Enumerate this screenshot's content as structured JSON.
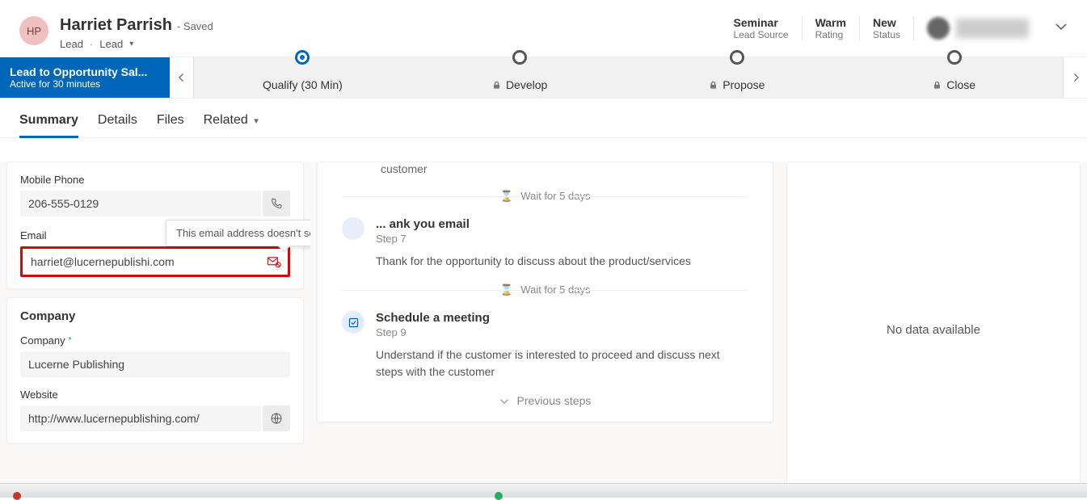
{
  "header": {
    "avatar_initials": "HP",
    "name": "Harriet Parrish",
    "saved": "- Saved",
    "entity": "Lead",
    "form": "Lead",
    "meta": [
      {
        "value": "Seminar",
        "label": "Lead Source"
      },
      {
        "value": "Warm",
        "label": "Rating"
      },
      {
        "value": "New",
        "label": "Status"
      }
    ]
  },
  "process": {
    "name": "Lead to Opportunity Sal...",
    "duration": "Active for 30 minutes",
    "stages": [
      {
        "label": "Qualify  (30 Min)",
        "active": true,
        "locked": false
      },
      {
        "label": "Develop",
        "active": false,
        "locked": true
      },
      {
        "label": "Propose",
        "active": false,
        "locked": true
      },
      {
        "label": "Close",
        "active": false,
        "locked": true
      }
    ]
  },
  "tabs": [
    {
      "label": "Summary",
      "active": true
    },
    {
      "label": "Details",
      "active": false
    },
    {
      "label": "Files",
      "active": false
    },
    {
      "label": "Related",
      "active": false,
      "dropdown": true
    }
  ],
  "fields": {
    "mobile_label": "Mobile Phone",
    "mobile_value": "206-555-0129",
    "email_label": "Email",
    "email_value": "harriet@lucernepublishi.com",
    "email_tooltip": "This email address doesn't seem to be valid.",
    "company_section": "Company",
    "company_label": "Company",
    "company_value": "Lucerne Publishing",
    "website_label": "Website",
    "website_value": "http://www.lucernepublishing.com/"
  },
  "timeline": {
    "leading_desc": "customer",
    "wait_text": "Wait for 5 days",
    "step7": {
      "title": "... ank you email",
      "sub": "Step 7",
      "body": "Thank for the opportunity to discuss about  the product/services"
    },
    "step9": {
      "title": "Schedule a meeting",
      "sub": "Step 9",
      "body": "Understand if the customer is interested to proceed and discuss next steps with the customer"
    },
    "previous": "Previous steps"
  },
  "right": {
    "empty": "No data available"
  }
}
